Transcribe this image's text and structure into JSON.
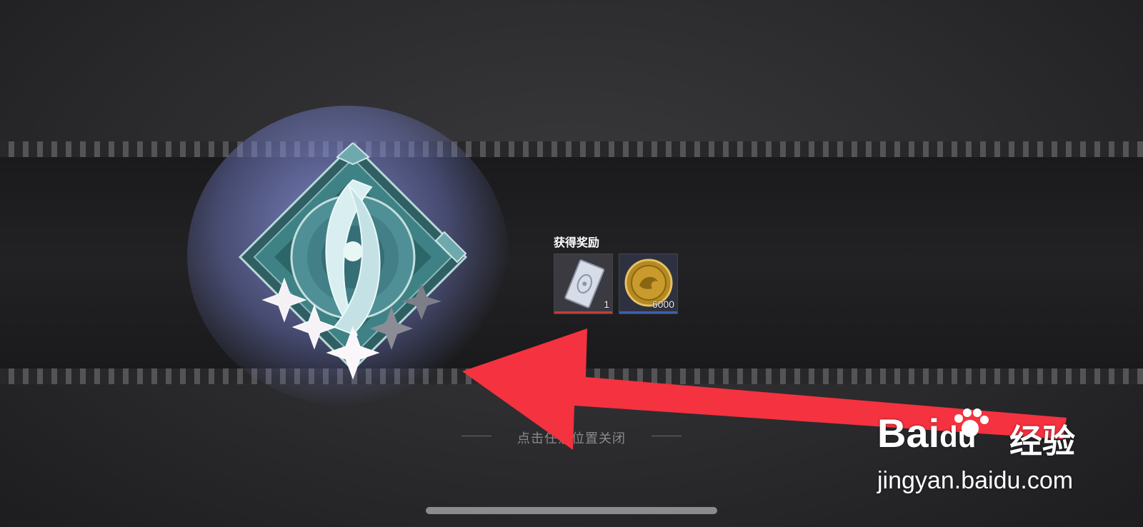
{
  "reward_panel": {
    "title": "获得奖励",
    "items": [
      {
        "name": "ticket-card",
        "icon": "card-ticket-icon",
        "count": "1",
        "accent": "#c43c3c"
      },
      {
        "name": "gold-coin",
        "icon": "gold-coin-icon",
        "count": "6000",
        "accent": "#3f5fb4"
      }
    ]
  },
  "badge": {
    "icon": "achievement-badge-icon",
    "stars_filled": 3,
    "stars_total": 5
  },
  "hint": {
    "text": "点击任意位置关闭"
  },
  "watermark": {
    "logo": "Bai",
    "logo_suffix": "du",
    "cn": "经验",
    "url": "jingyan.baidu.com"
  },
  "colors": {
    "arrow": "#f5323f",
    "glow": "#8c96e6",
    "badge_teal": "#5a9ca0"
  }
}
